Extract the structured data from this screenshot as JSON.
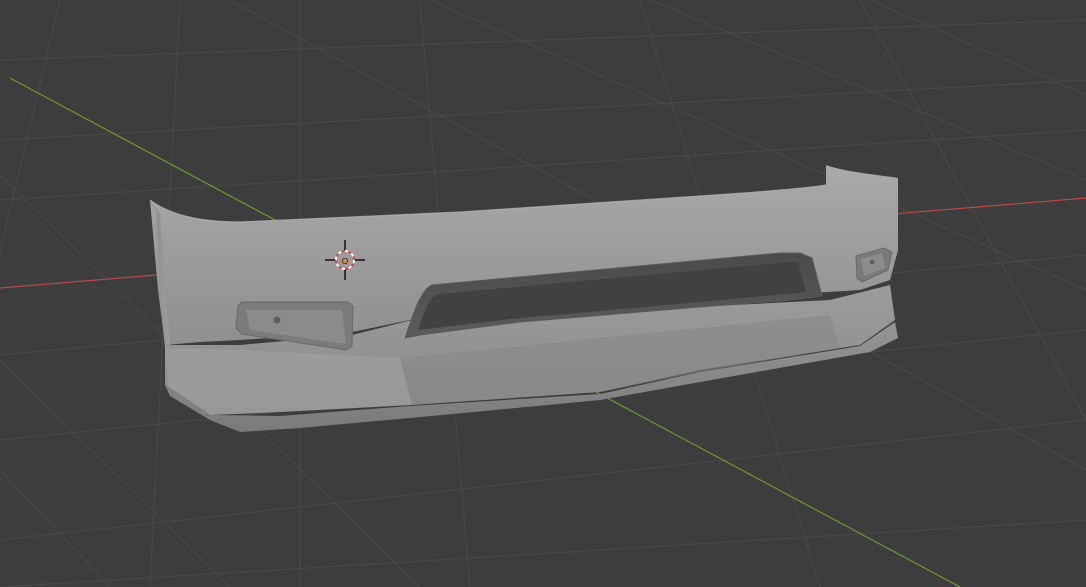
{
  "viewport": {
    "mode": "3d-viewport",
    "view": "perspective",
    "background_color": "#3d3d3d",
    "grid_line_color": "#4a4a4a",
    "x_axis_color": "#b34a4a",
    "y_axis_color": "#6f9a2c"
  },
  "scene": {
    "object": "front-bumper-mesh",
    "object_shading": "solid",
    "object_color": "#9a9a9a",
    "cursor_icon": "3d-cursor-icon",
    "origin_icon": "object-origin-icon",
    "origin_color": "#f08a1c"
  }
}
